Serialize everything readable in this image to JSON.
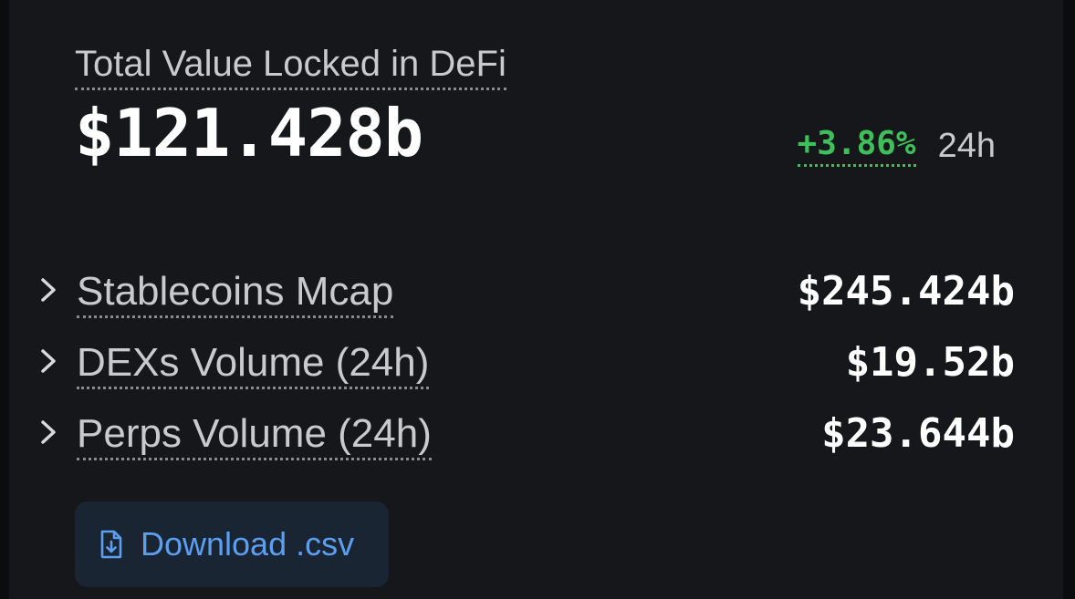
{
  "tvl": {
    "label": "Total Value Locked in DeFi",
    "value": "$121.428b",
    "change": "+3.86%",
    "period": "24h"
  },
  "metrics": [
    {
      "label": "Stablecoins Mcap",
      "value": "$245.424b",
      "icon": "chevron-right-icon"
    },
    {
      "label": "DEXs Volume (24h)",
      "value": "$19.52b",
      "icon": "chevron-right-icon"
    },
    {
      "label": "Perps Volume (24h)",
      "value": "$23.644b",
      "icon": "chevron-right-icon"
    }
  ],
  "download": {
    "label": "Download .csv",
    "icon": "file-download-icon"
  },
  "colors": {
    "background": "#16171a",
    "positive": "#3fbf5a",
    "accent": "#5c9ef0",
    "button_bg": "#1a2533"
  }
}
